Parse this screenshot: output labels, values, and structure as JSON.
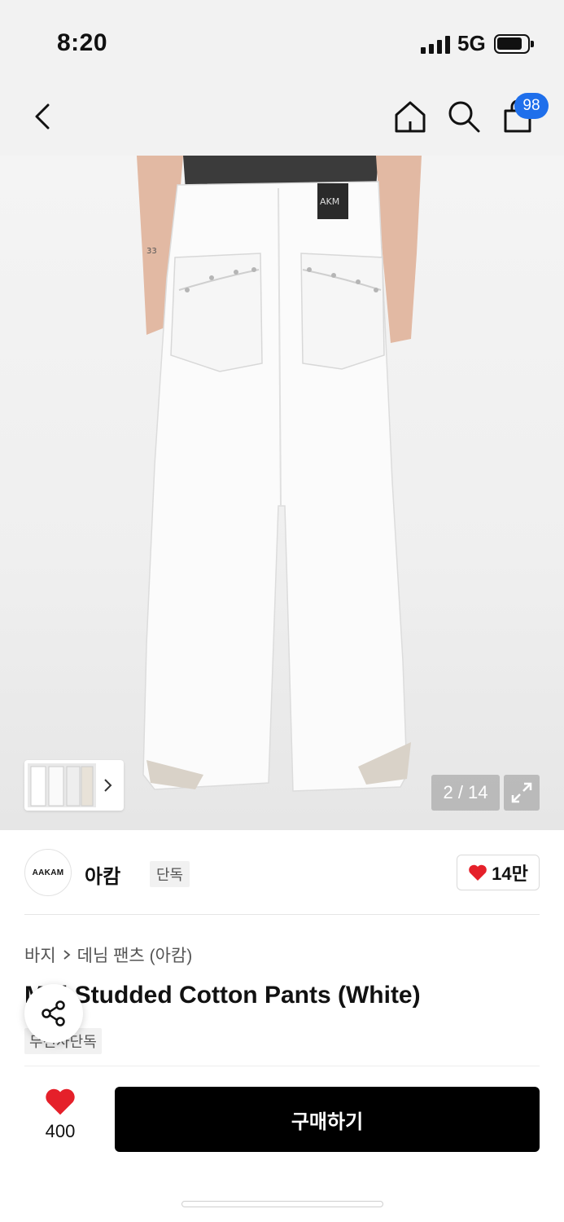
{
  "status_bar": {
    "time": "8:20",
    "network": "5G"
  },
  "top_nav": {
    "back_icon": "chevron-left-icon",
    "home_icon": "home-icon",
    "search_icon": "search-icon",
    "cart_icon": "shopping-bag-icon",
    "cart_badge": "98",
    "badge_color": "#1f6feb"
  },
  "gallery": {
    "page_counter": "2 / 14",
    "expand_icon": "expand-icon"
  },
  "brand": {
    "logo_text": "AAKAM",
    "name": "아캄",
    "tag": "단독",
    "likes": "14만",
    "heart_color": "#e5202a"
  },
  "product": {
    "breadcrumb_category": "바지",
    "breadcrumb_sub": "데님 팬츠 (아캄)",
    "title": "M    ri Studded Cotton Pants (White)",
    "exclusive_tag": "무신사단독"
  },
  "bottom_bar": {
    "wish_count": "400",
    "buy_label": "구매하기"
  }
}
